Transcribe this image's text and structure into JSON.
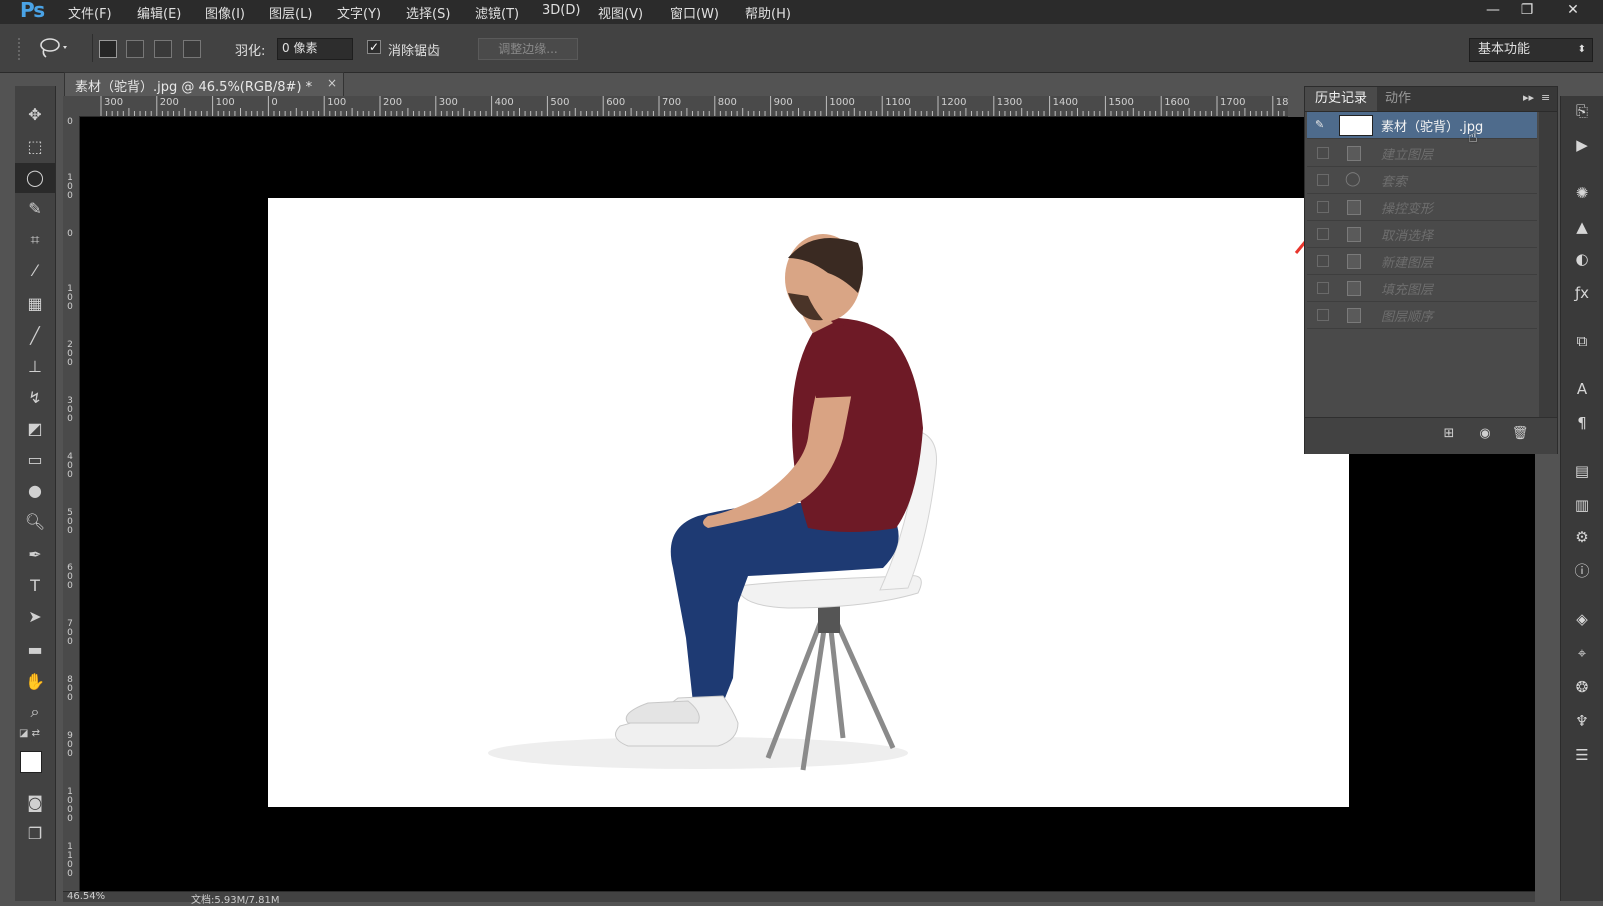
{
  "app": {
    "logo": "Ps",
    "menu": [
      "文件(F)",
      "编辑(E)",
      "图像(I)",
      "图层(L)",
      "文字(Y)",
      "选择(S)",
      "滤镜(T)",
      "3D(D)",
      "视图(V)",
      "窗口(W)",
      "帮助(H)"
    ],
    "window_buttons": [
      "—",
      "❐",
      "✕"
    ]
  },
  "options": {
    "feather_label": "羽化:",
    "feather_value": "0 像素",
    "antialias_label": "消除锯齿",
    "antialias_checked": true,
    "refine_edge_label": "调整边缘...",
    "workspace": "基本功能"
  },
  "document": {
    "tab_title": "素材（驼背）.jpg @ 46.5%(RGB/8#) *",
    "close": "×"
  },
  "ruler": {
    "top_ticks": [
      "300",
      "200",
      "100",
      "0",
      "100",
      "200",
      "300",
      "400",
      "500",
      "600",
      "700",
      "800",
      "900",
      "1000",
      "1100",
      "1200",
      "1300",
      "1400",
      "1500",
      "1600",
      "1700",
      "18"
    ],
    "left_ticks": [
      "0",
      "100",
      "0",
      "100",
      "200",
      "300",
      "400",
      "500",
      "600",
      "700",
      "800",
      "900",
      "1000",
      "1100",
      "1"
    ]
  },
  "history_panel": {
    "tabs": [
      "历史记录",
      "动作"
    ],
    "items": [
      {
        "label": "素材（驼背）.jpg",
        "snapshot": true
      },
      {
        "label": "建立图层",
        "snapshot": false
      },
      {
        "label": "套索",
        "snapshot": false
      },
      {
        "label": "操控变形",
        "snapshot": false
      },
      {
        "label": "取消选择",
        "snapshot": false
      },
      {
        "label": "新建图层",
        "snapshot": false
      },
      {
        "label": "填充图层",
        "snapshot": false
      },
      {
        "label": "图层顺序",
        "snapshot": false
      }
    ]
  },
  "status": {
    "zoom": "46.54%",
    "doc_size": "文档:5.93M/7.81M"
  },
  "colors": {
    "menubar": "#2b2b2b",
    "panel": "#424242",
    "canvas": "#000000",
    "history_selected": "#4e6b8c",
    "annotation_arrow": "#e8352c"
  }
}
